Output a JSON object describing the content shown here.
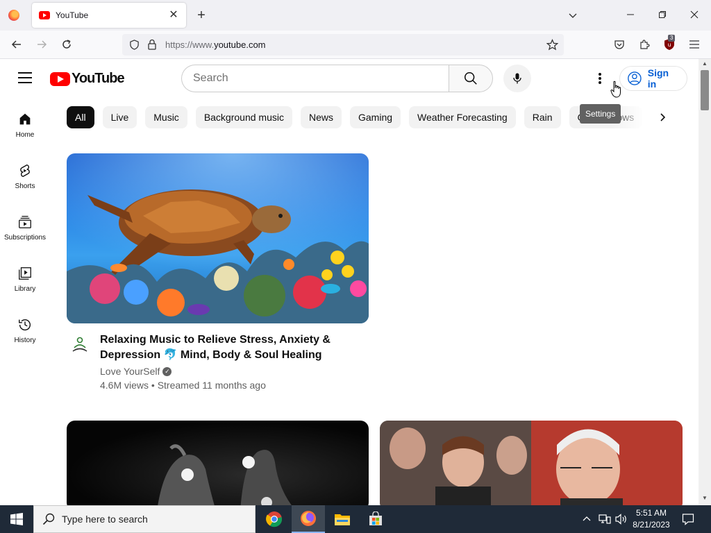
{
  "browser": {
    "tab_title": "YouTube",
    "url_prefix": "https://www.",
    "url_domain": "youtube.com",
    "extension_badge": "3"
  },
  "youtube": {
    "logo_text": "YouTube",
    "search_placeholder": "Search",
    "sign_in_label": "Sign in",
    "settings_tooltip": "Settings",
    "chips": [
      "All",
      "Live",
      "Music",
      "Background music",
      "News",
      "Gaming",
      "Weather Forecasting",
      "Rain",
      "Game shows"
    ],
    "sidebar": [
      {
        "label": "Home",
        "icon": "home-icon"
      },
      {
        "label": "Shorts",
        "icon": "shorts-icon"
      },
      {
        "label": "Subscriptions",
        "icon": "subscriptions-icon"
      },
      {
        "label": "Library",
        "icon": "library-icon"
      },
      {
        "label": "History",
        "icon": "history-icon"
      }
    ],
    "video": {
      "title": "Relaxing Music to Relieve Stress, Anxiety & Depression 🐬 Mind, Body & Soul Healing",
      "channel": "Love YourSelf",
      "meta": "4.6M views • Streamed 11 months ago"
    }
  },
  "taskbar": {
    "search_placeholder": "Type here to search",
    "time": "5:51 AM",
    "date": "8/21/2023"
  },
  "colors": {
    "youtube_red": "#ff0000",
    "link_blue": "#065fd4",
    "taskbar": "#1f2a38"
  }
}
